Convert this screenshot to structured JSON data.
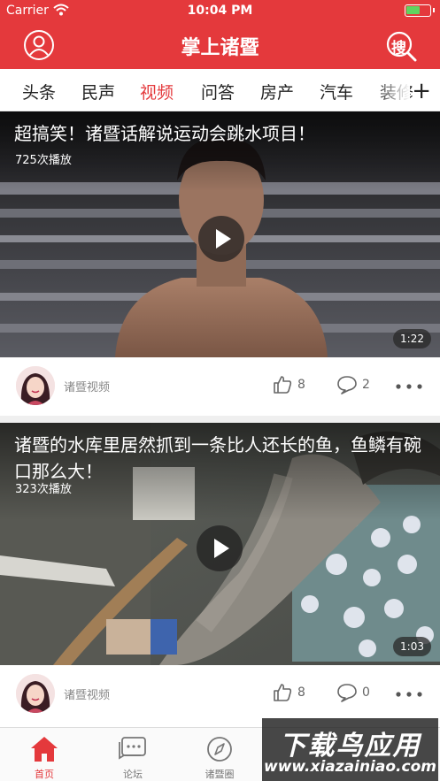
{
  "status_bar": {
    "carrier": "Carrier",
    "time": "10:04 PM",
    "battery_level": 0.6
  },
  "header": {
    "title": "掌上诸暨",
    "search_label": "搜"
  },
  "categories": {
    "items": [
      "头条",
      "民声",
      "视频",
      "问答",
      "房产",
      "汽车",
      "装修"
    ],
    "active": "视频",
    "more_label": "+"
  },
  "videos": [
    {
      "title": "超搞笑！诸暨话解说运动会跳水项目！",
      "views": "725次播放",
      "duration": "1:22",
      "source": "诸暨视频",
      "likes": "8",
      "comments": "2"
    },
    {
      "title": "诸暨的水库里居然抓到一条比人还长的鱼，鱼鳞有碗口那么大！",
      "views": "323次播放",
      "duration": "1:03",
      "source": "诸暨视频",
      "likes": "8",
      "comments": "0"
    }
  ],
  "tab_bar": {
    "items": [
      {
        "label": "首页",
        "icon": "home-icon",
        "active": true
      },
      {
        "label": "论坛",
        "icon": "forum-icon",
        "active": false
      },
      {
        "label": "诸暨圈",
        "icon": "compass-icon",
        "active": false
      }
    ]
  },
  "watermark": {
    "title": "下载鸟应用",
    "url": "www.xiazainiao.com"
  },
  "colors": {
    "brand_red": "#e4393c",
    "inactive_gray": "#777777"
  }
}
